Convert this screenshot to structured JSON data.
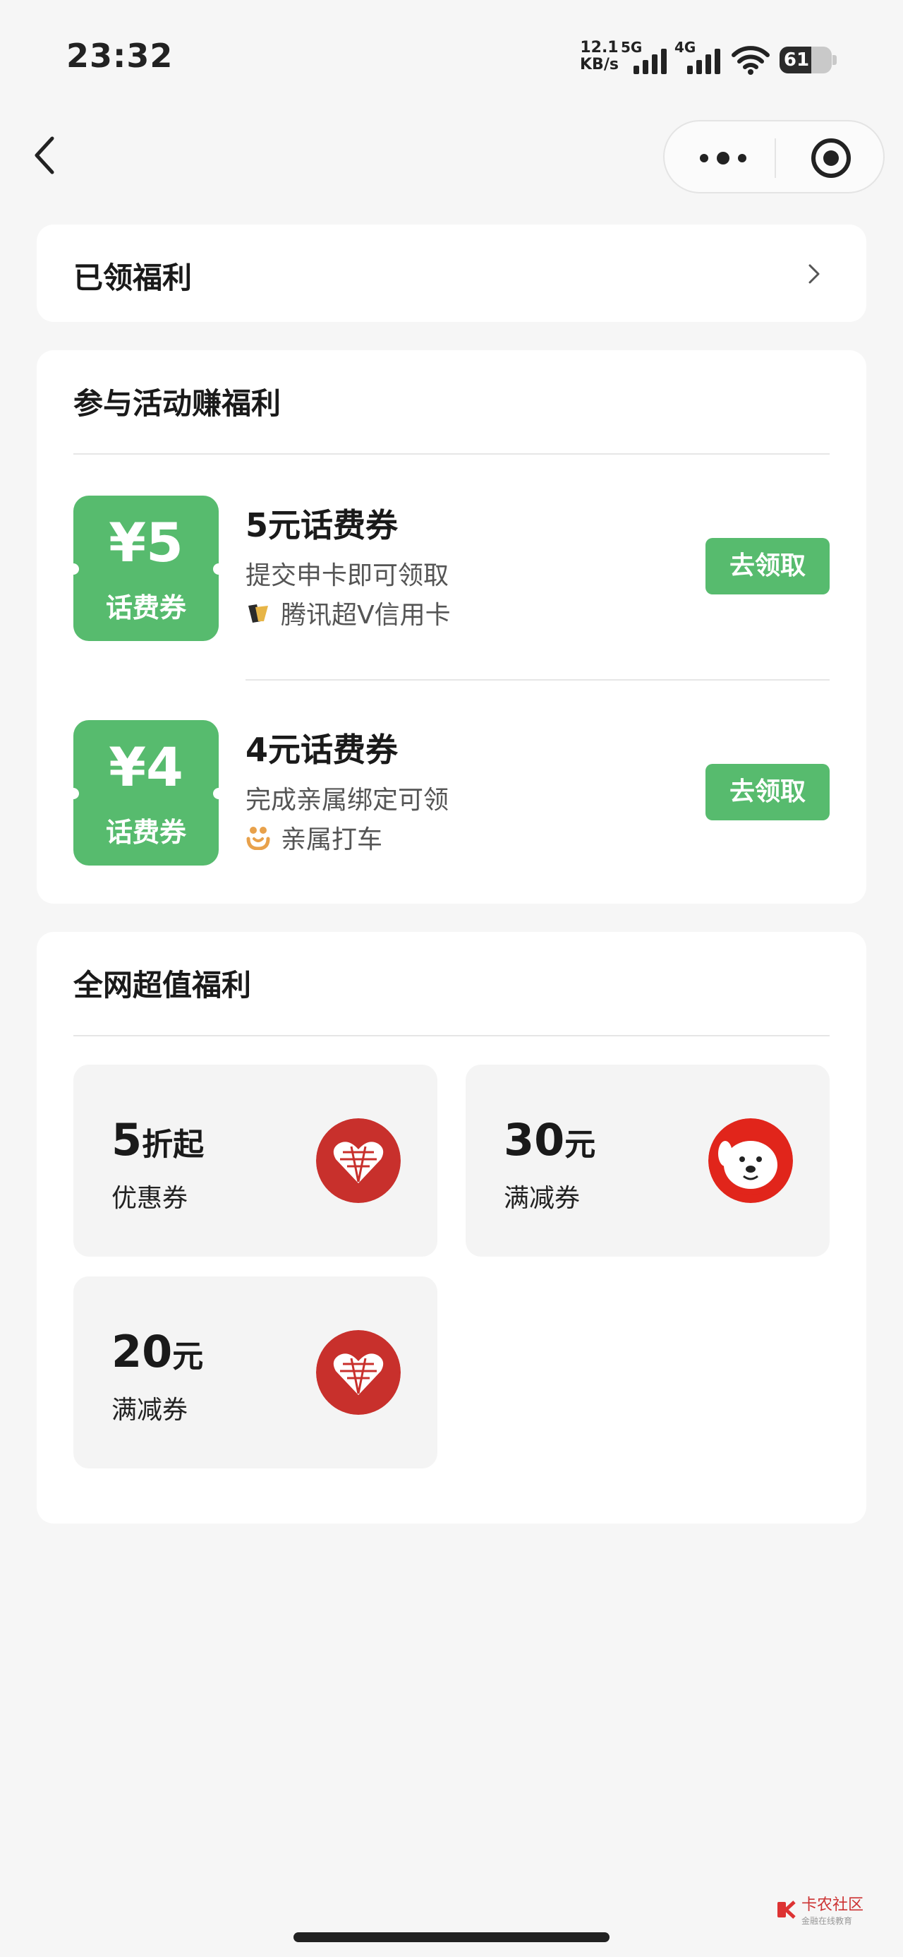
{
  "status_bar": {
    "time": "23:32",
    "net_speed_value": "12.1",
    "net_speed_unit": "KB/s",
    "sig1_label": "5G",
    "sig2_label": "4G",
    "battery": "61",
    "battery_level": 0.61
  },
  "nav": {
    "back_icon": "chevron-left-icon",
    "more_icon": "more-dots-icon",
    "close_icon": "target-icon"
  },
  "claimed": {
    "title": "已领福利"
  },
  "activities": {
    "title": "参与活动赚福利",
    "items": [
      {
        "amount": "¥5",
        "coupon_label": "话费券",
        "title": "5元话费券",
        "desc": "提交申卡即可领取",
        "source": "腾讯超V信用卡",
        "button": "去领取"
      },
      {
        "amount": "¥4",
        "coupon_label": "话费券",
        "title": "4元话费券",
        "desc": "完成亲属绑定可领",
        "source": "亲属打车",
        "button": "去领取"
      }
    ]
  },
  "deals": {
    "title": "全网超值福利",
    "items": [
      {
        "value": "5",
        "unit": "折起",
        "label": "优惠券",
        "logo": "pinduoduo-logo"
      },
      {
        "value": "30",
        "unit": "元",
        "label": "满减券",
        "logo": "jd-dog-logo"
      },
      {
        "value": "20",
        "unit": "元",
        "label": "满减券",
        "logo": "pinduoduo-logo"
      }
    ]
  },
  "watermark": {
    "name": "卡农社区",
    "sub": "金融在线教育"
  },
  "colors": {
    "green": "#57bb6e",
    "pdd_red": "#c8302c",
    "jd_red": "#e1251b"
  }
}
